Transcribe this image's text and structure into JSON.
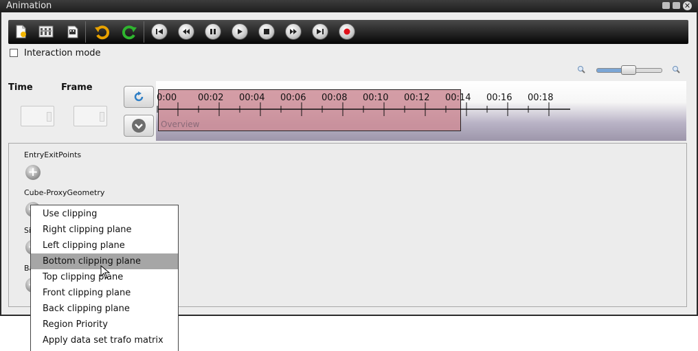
{
  "window": {
    "title": "Animation"
  },
  "toolbar": {
    "buttons": [
      {
        "name": "new-animation-icon"
      },
      {
        "name": "animation-settings-icon"
      },
      {
        "name": "export-animation-icon"
      },
      {
        "name": "undo-icon"
      },
      {
        "name": "redo-icon"
      },
      {
        "name": "skip-to-start-icon"
      },
      {
        "name": "rewind-icon"
      },
      {
        "name": "pause-icon"
      },
      {
        "name": "play-icon"
      },
      {
        "name": "stop-icon"
      },
      {
        "name": "fast-forward-icon"
      },
      {
        "name": "skip-to-end-icon"
      },
      {
        "name": "record-icon"
      }
    ]
  },
  "interaction_mode": {
    "label": "Interaction mode",
    "checked": false
  },
  "time": {
    "label": "Time",
    "value": ""
  },
  "frame": {
    "label": "Frame",
    "value": ""
  },
  "zoom": {
    "level_fraction": 0.5
  },
  "timeline": {
    "ticks": [
      "0:00",
      "00:02",
      "00:04",
      "00:06",
      "00:08",
      "00:10",
      "00:12",
      "00:14",
      "00:16",
      "00:18"
    ],
    "overview_label": "Overview"
  },
  "tracks": [
    {
      "label": "EntryExitPoints"
    },
    {
      "label": "Cube-ProxyGeometry"
    },
    {
      "label": "Sing"
    },
    {
      "label": "Bac"
    }
  ],
  "context_menu": {
    "items": [
      "Use clipping",
      "Right clipping plane",
      "Left clipping plane",
      "Bottom clipping plane",
      "Top clipping plane",
      "Front clipping plane",
      "Back clipping plane",
      "Region Priority",
      "Apply data set trafo matrix"
    ],
    "hovered_index": 3
  },
  "colors": {
    "record": "#e0101a",
    "overview": "#cd8c96",
    "hover": "#a6a6a6"
  }
}
